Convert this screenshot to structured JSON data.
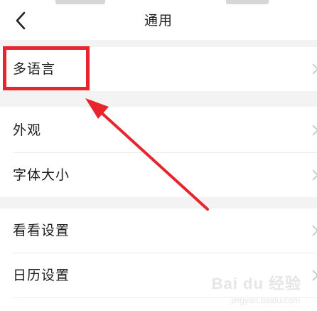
{
  "header": {
    "title": "通用",
    "back_icon": "chevron-left-icon"
  },
  "settings": {
    "section1": [
      {
        "label": "多语言"
      }
    ],
    "section2": [
      {
        "label": "外观"
      },
      {
        "label": "字体大小"
      }
    ],
    "section3": [
      {
        "label": "看看设置"
      },
      {
        "label": "日历设置"
      }
    ]
  },
  "annotation": {
    "highlight_color": "#e8242c",
    "arrow_color": "#e8242c"
  },
  "watermark": {
    "text": "Bai du 经验",
    "sub": "jingyan.baidu.com"
  }
}
